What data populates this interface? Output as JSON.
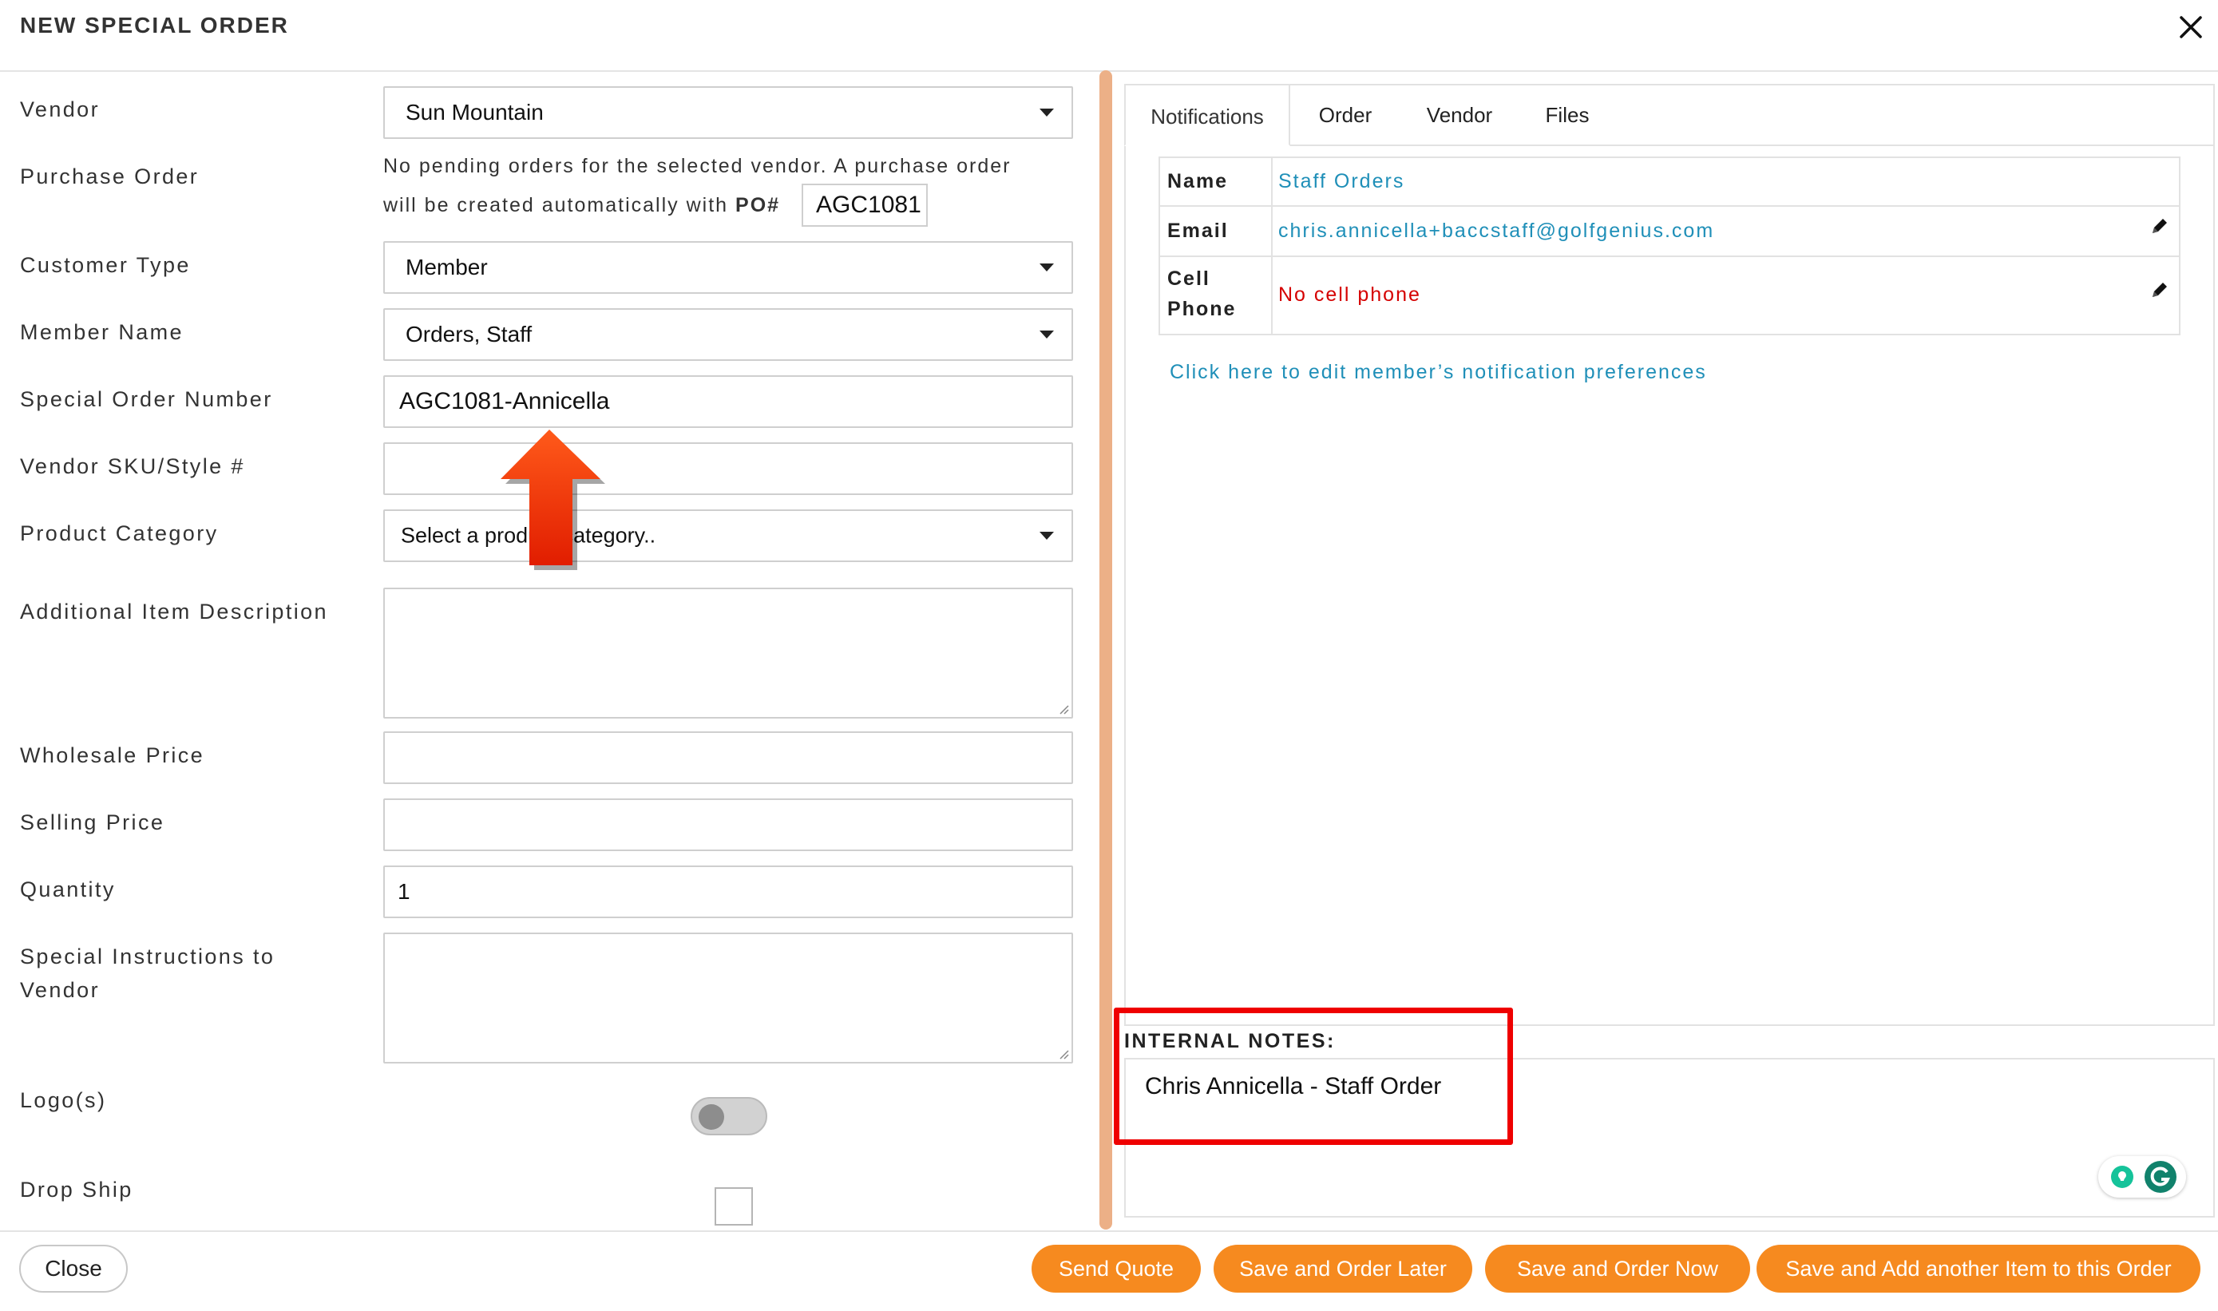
{
  "dialog": {
    "title": "NEW SPECIAL ORDER"
  },
  "form": {
    "vendor": {
      "label": "Vendor",
      "value": "Sun Mountain"
    },
    "purchase_order": {
      "label": "Purchase Order",
      "message_line1": "No pending orders for the selected vendor. A purchase order",
      "message_line2": "will be created automatically with",
      "po_label": "PO#",
      "po_value": "AGC1081"
    },
    "customer_type": {
      "label": "Customer Type",
      "value": "Member"
    },
    "member_name": {
      "label": "Member Name",
      "value": "Orders, Staff"
    },
    "special_order_number": {
      "label": "Special Order Number",
      "value": "AGC1081-Annicella"
    },
    "vendor_sku": {
      "label": "Vendor SKU/Style #",
      "value": ""
    },
    "product_category": {
      "label": "Product Category",
      "value": "Select a product category.."
    },
    "additional_description": {
      "label": "Additional Item Description",
      "value": ""
    },
    "wholesale_price": {
      "label": "Wholesale Price",
      "value": ""
    },
    "selling_price": {
      "label": "Selling Price",
      "value": ""
    },
    "quantity": {
      "label": "Quantity",
      "value": "1"
    },
    "special_instructions": {
      "label_line1": "Special Instructions to",
      "label_line2": "Vendor",
      "value": ""
    },
    "logos": {
      "label": "Logo(s)",
      "enabled": false
    },
    "drop_ship": {
      "label": "Drop Ship",
      "checked": false
    }
  },
  "right_panel": {
    "tabs": [
      {
        "label": "Notifications",
        "active": true
      },
      {
        "label": "Order",
        "active": false
      },
      {
        "label": "Vendor",
        "active": false
      },
      {
        "label": "Files",
        "active": false
      }
    ],
    "info": {
      "name_label": "Name",
      "name_value": "Staff Orders",
      "email_label": "Email",
      "email_value": "chris.annicella+baccstaff@golfgenius.com",
      "cell_label_line1": "Cell",
      "cell_label_line2": "Phone",
      "cell_value": "No cell phone"
    },
    "notification_link": "Click here to edit member’s notification preferences",
    "internal_notes": {
      "label": "INTERNAL NOTES:",
      "value": "Chris Annicella - Staff Order"
    }
  },
  "footer": {
    "close_label": "Close",
    "send_quote_label": "Send Quote",
    "save_order_later_label": "Save and Order Later",
    "save_order_now_label": "Save and Order Now",
    "save_add_label": "Save and Add another Item to this Order"
  },
  "colors": {
    "accent_orange": "#f68a1f",
    "link_blue": "#1f8fb8",
    "error_red": "#d50000",
    "annotation_red": "#ef0000",
    "scrollbar": "#ecb087"
  }
}
